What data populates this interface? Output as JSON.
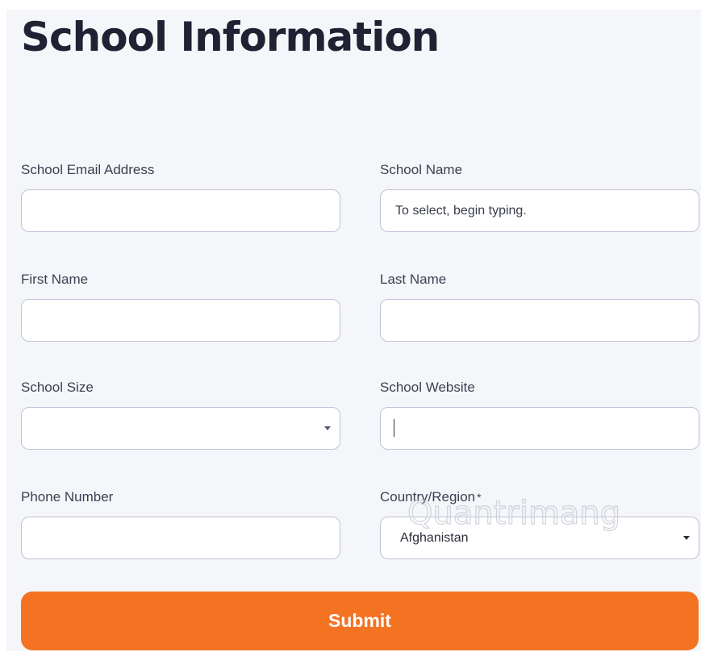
{
  "page": {
    "title": "School Information"
  },
  "form": {
    "email": {
      "label": "School Email Address",
      "value": "",
      "placeholder": ""
    },
    "school_name": {
      "label": "School Name",
      "value": "",
      "placeholder": "To select, begin typing."
    },
    "first_name": {
      "label": "First Name",
      "value": "",
      "placeholder": ""
    },
    "last_name": {
      "label": "Last Name",
      "value": "",
      "placeholder": ""
    },
    "school_size": {
      "label": "School Size",
      "selected": ""
    },
    "website": {
      "label": "School Website",
      "value": "",
      "placeholder": ""
    },
    "phone": {
      "label": "Phone Number",
      "value": "",
      "placeholder": ""
    },
    "country": {
      "label": "Country/Region",
      "required_mark": "*",
      "selected": "Afghanistan"
    },
    "submit_label": "Submit"
  },
  "watermark": {
    "text": "Quantrimang"
  },
  "colors": {
    "accent": "#f37323",
    "background": "#f5f6f9",
    "border": "#bfc2d8",
    "title": "#1f2233"
  }
}
